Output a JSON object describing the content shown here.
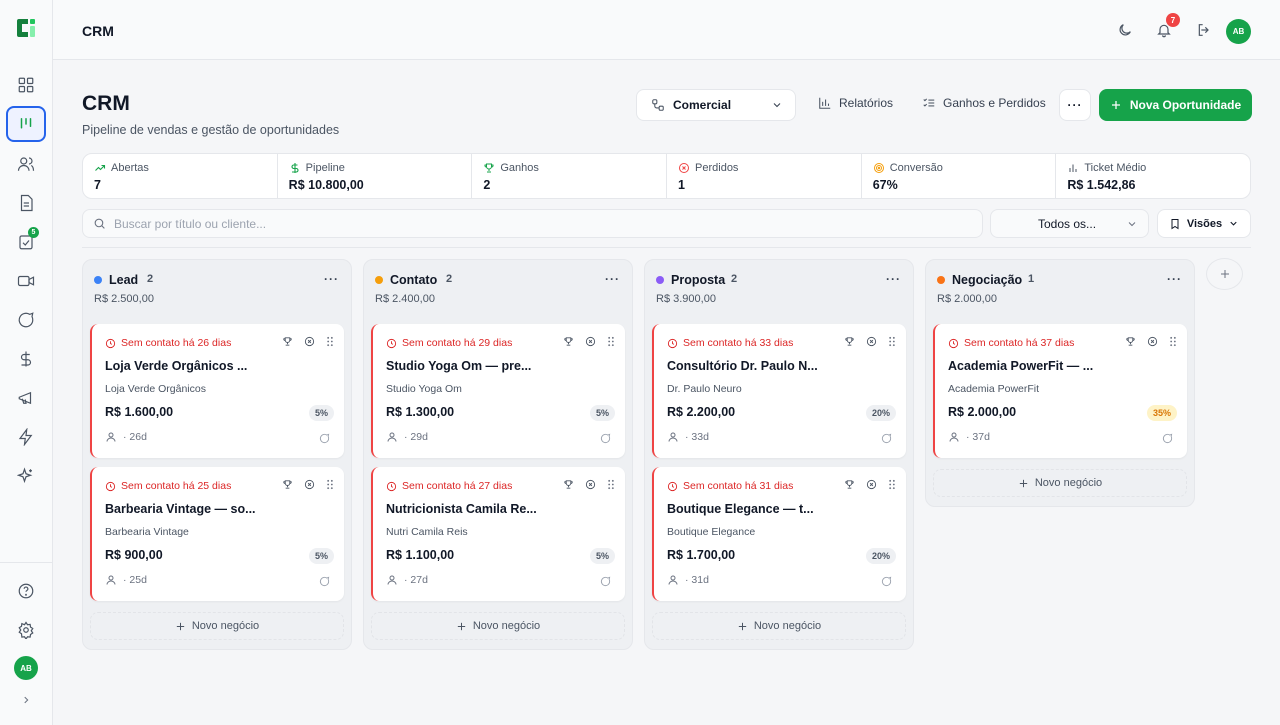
{
  "app": {
    "title": "CRM"
  },
  "user": {
    "initials": "AB",
    "notifications": "7"
  },
  "sidebar": {
    "tasks_badge": "5"
  },
  "header": {
    "title": "CRM",
    "subtitle": "Pipeline de vendas e gestão de oportunidades",
    "pipeline_select": "Comercial",
    "reports_label": "Relatórios",
    "wins_losses_label": "Ganhos e Perdidos",
    "more_label": "···",
    "new_button": "Nova Oportunidade"
  },
  "stats": [
    {
      "label": "Abertas",
      "value": "7"
    },
    {
      "label": "Pipeline",
      "value": "R$ 10.800,00"
    },
    {
      "label": "Ganhos",
      "value": "2"
    },
    {
      "label": "Perdidos",
      "value": "1"
    },
    {
      "label": "Conversão",
      "value": "67%"
    },
    {
      "label": "Ticket Médio",
      "value": "R$ 1.542,86"
    }
  ],
  "filters": {
    "search_placeholder": "Buscar por título ou cliente...",
    "owner_select": "Todos os...",
    "views_label": "Visões"
  },
  "add_deal_label": "Novo negócio",
  "columns": [
    {
      "name": "Lead",
      "count": "2",
      "total": "R$ 2.500,00",
      "color": "#3b82f6",
      "cards": [
        {
          "alert": "Sem contato há 26 dias",
          "title": "Loja Verde Orgânicos ...",
          "client": "Loja Verde Orgânicos",
          "value": "R$ 1.600,00",
          "prob": "5%",
          "age": "· 26d"
        },
        {
          "alert": "Sem contato há 25 dias",
          "title": "Barbearia Vintage — so...",
          "client": "Barbearia Vintage",
          "value": "R$ 900,00",
          "prob": "5%",
          "age": "· 25d"
        }
      ]
    },
    {
      "name": "Contato",
      "count": "2",
      "total": "R$ 2.400,00",
      "color": "#f59e0b",
      "cards": [
        {
          "alert": "Sem contato há 29 dias",
          "title": "Studio Yoga Om — pre...",
          "client": "Studio Yoga Om",
          "value": "R$ 1.300,00",
          "prob": "5%",
          "age": "· 29d"
        },
        {
          "alert": "Sem contato há 27 dias",
          "title": "Nutricionista Camila Re...",
          "client": "Nutri Camila Reis",
          "value": "R$ 1.100,00",
          "prob": "5%",
          "age": "· 27d"
        }
      ]
    },
    {
      "name": "Proposta",
      "count": "2",
      "total": "R$ 3.900,00",
      "color": "#8b5cf6",
      "cards": [
        {
          "alert": "Sem contato há 33 dias",
          "title": "Consultório Dr. Paulo N...",
          "client": "Dr. Paulo Neuro",
          "value": "R$ 2.200,00",
          "prob": "20%",
          "age": "· 33d"
        },
        {
          "alert": "Sem contato há 31 dias",
          "title": "Boutique Elegance — t...",
          "client": "Boutique Elegance",
          "value": "R$ 1.700,00",
          "prob": "20%",
          "age": "· 31d"
        }
      ]
    },
    {
      "name": "Negociação",
      "count": "1",
      "total": "R$ 2.000,00",
      "color": "#f97316",
      "cards": [
        {
          "alert": "Sem contato há 37 dias",
          "title": "Academia PowerFit — ...",
          "client": "Academia PowerFit",
          "value": "R$ 2.000,00",
          "prob": "35%",
          "age": "· 37d"
        }
      ]
    }
  ]
}
